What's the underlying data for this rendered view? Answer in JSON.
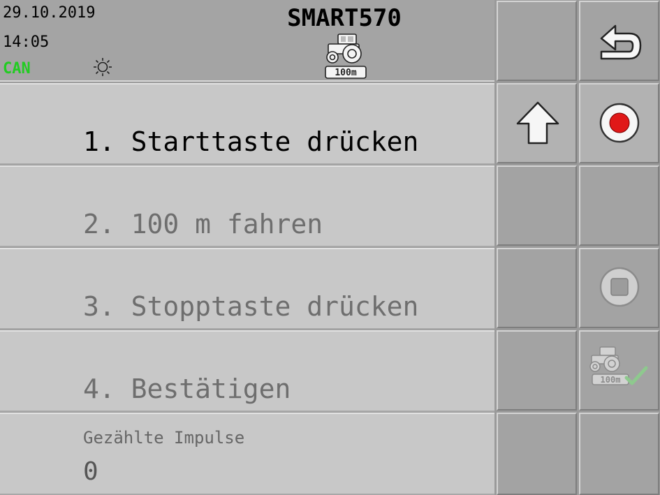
{
  "header": {
    "date": "29.10.2019",
    "time": "14:05",
    "bus_status": "CAN",
    "bus_status_color": "#22cc22",
    "title": "SMART570",
    "badge": "100m",
    "icons": [
      "sun-icon",
      "tractor-distance-icon"
    ]
  },
  "steps": [
    {
      "label": "1. Starttaste drücken",
      "active": true
    },
    {
      "label": "2. 100 m fahren",
      "active": false
    },
    {
      "label": "3. Stopptaste drücken",
      "active": false
    },
    {
      "label": "4. Bestätigen",
      "active": false
    }
  ],
  "impulse": {
    "label": "Gezählte Impulse",
    "value": "0"
  },
  "softkeys": {
    "back_icon": "back-arrow-icon",
    "up_icon": "arrow-up-icon",
    "record_icon": "record-icon",
    "record_color": "#e01818",
    "stop_icon": "stop-icon",
    "confirm_icon": "tractor-confirm-icon",
    "confirm_badge": "100m",
    "confirm_check_color": "#8ec98e"
  }
}
